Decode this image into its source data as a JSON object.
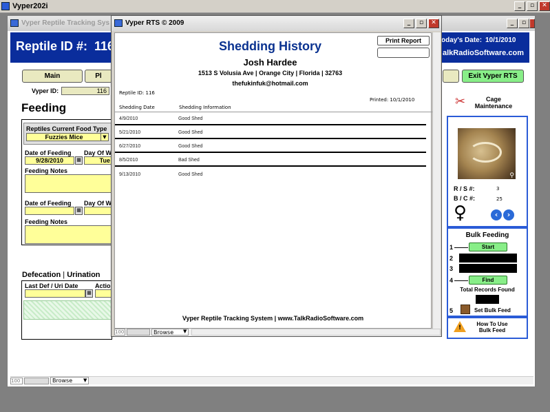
{
  "outer": {
    "title": "Vyper202i",
    "min": "_",
    "restore": "▫",
    "close": "✕"
  },
  "main": {
    "title": "Vyper Reptile Tracking Sys",
    "header_label": "Reptile ID #:",
    "header_id": "116",
    "today_label": "oday's Date:",
    "today_value": "10/1/2010",
    "site": "alkRadioSoftware.com",
    "nav_main": "Main",
    "nav_pl": "Pl",
    "exit": "Exit Vyper RTS",
    "vyper_id_label": "Vyper ID:",
    "vyper_id": "116",
    "section_feeding": "Feeding",
    "food_type_label": "Reptiles Current Food Type",
    "food_type_value": "Fuzzies Mice",
    "date_feeding_label": "Date of Feeding",
    "day_of_week_label": "Day Of W",
    "date_feeding_1": "9/28/2010",
    "day_1": "Tue",
    "feeding_notes_label": "Feeding Notes",
    "date_feeding_label_2": "Date of Feeding",
    "day_of_week_label_2": "Day Of W",
    "feeding_notes_label_2": "Feeding Notes",
    "section_defecation": "Defecation",
    "section_sep": " | ",
    "section_urination": "Urination",
    "last_def_label": "Last Def / Uri Date",
    "action_label": "Actio",
    "cage_maintenance": "Cage Maintenance",
    "rs_label": "R / S #:",
    "rs_value": "3",
    "bc_label": "B / C #:",
    "bc_value": "25",
    "gender_symbol": "♀",
    "bulk_title": "Bulk Feeding",
    "step1": "1",
    "step2": "2",
    "step3": "3",
    "step4": "4",
    "step5": "5",
    "start": "Start",
    "find": "Find",
    "total_records": "Total Records Found",
    "set_bulk_feed": "Set Bulk Feed",
    "how_to_use": "How To Use Bulk Feed",
    "status_num": "100",
    "browse": "Browse"
  },
  "report": {
    "title": "Vyper RTS © 2009",
    "print_report": "Print Report",
    "heading": "Shedding History",
    "name": "Josh Hardee",
    "address": "1513 S Volusia Ave | Orange City | Florida | 32763",
    "email": "thefukinfuk@hotmail.com",
    "reptile_id": "Reptile ID: 116",
    "printed": "Printed:  10/1/2010",
    "col_date": "Shedding Date",
    "col_info": "Shedding Information",
    "rows": [
      {
        "date": "4/9/2010",
        "info": "Good Shed"
      },
      {
        "date": "5/21/2010",
        "info": "Good Shed"
      },
      {
        "date": "6/27/2010",
        "info": "Good Shed"
      },
      {
        "date": "8/5/2010",
        "info": "Bad Shed"
      },
      {
        "date": "9/13/2010",
        "info": "Good Shed"
      }
    ],
    "footer": "Vyper Reptile Tracking System | www.TalkRadioSoftware.com",
    "status_num": "100",
    "browse": "Browse"
  },
  "colors": {
    "header_blue": "#0a2d9c",
    "field_yellow": "#ffff99",
    "green_button": "#88ee88"
  }
}
